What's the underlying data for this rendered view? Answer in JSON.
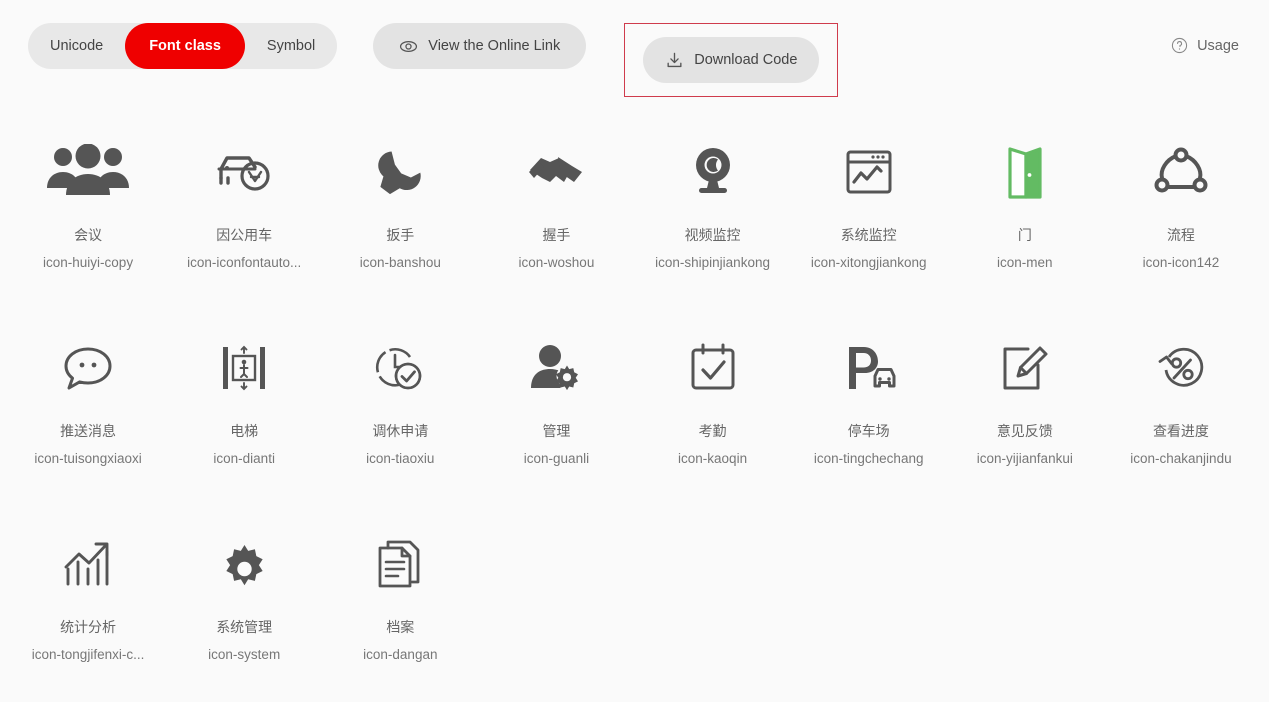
{
  "header": {
    "tabs": [
      {
        "label": "Unicode",
        "active": false
      },
      {
        "label": "Font class",
        "active": true
      },
      {
        "label": "Symbol",
        "active": false
      }
    ],
    "online_link_label": "View the Online Link",
    "online_link_icon": "eye-icon",
    "download_label": "Download Code",
    "download_icon": "download-icon",
    "usage_label": "Usage",
    "usage_icon": "question-circle-icon",
    "accent_color": "#ef0000",
    "highlight_border_color": "#cf3b4c",
    "pill_bg": "#e3e3e3"
  },
  "icons": [
    {
      "name": "会议",
      "code": "icon-huiyi-copy",
      "glyph": "users-group-icon",
      "color": "#555555"
    },
    {
      "name": "因公用车",
      "code": "icon-iconfontauto...",
      "glyph": "official-car-icon",
      "color": "#555555"
    },
    {
      "name": "扳手",
      "code": "icon-banshou",
      "glyph": "wrench-icon",
      "color": "#555555"
    },
    {
      "name": "握手",
      "code": "icon-woshou",
      "glyph": "handshake-icon",
      "color": "#555555"
    },
    {
      "name": "视频监控",
      "code": "icon-shipinjiankong",
      "glyph": "webcam-icon",
      "color": "#555555"
    },
    {
      "name": "系统监控",
      "code": "icon-xitongjiankong",
      "glyph": "system-monitor-icon",
      "color": "#555555"
    },
    {
      "name": "门",
      "code": "icon-men",
      "glyph": "door-icon",
      "color": "#63bb63"
    },
    {
      "name": "流程",
      "code": "icon-icon142",
      "glyph": "flow-nodes-icon",
      "color": "#555555"
    },
    {
      "name": "推送消息",
      "code": "icon-tuisongxiaoxi",
      "glyph": "chat-bubble-icon",
      "color": "#555555"
    },
    {
      "name": "电梯",
      "code": "icon-dianti",
      "glyph": "elevator-icon",
      "color": "#555555"
    },
    {
      "name": "调休申请",
      "code": "icon-tiaoxiu",
      "glyph": "clock-check-icon",
      "color": "#555555"
    },
    {
      "name": "管理",
      "code": "icon-guanli",
      "glyph": "user-gear-icon",
      "color": "#555555"
    },
    {
      "name": "考勤",
      "code": "icon-kaoqin",
      "glyph": "calendar-check-icon",
      "color": "#555555"
    },
    {
      "name": "停车场",
      "code": "icon-tingchechang",
      "glyph": "parking-car-icon",
      "color": "#555555"
    },
    {
      "name": "意见反馈",
      "code": "icon-yijianfankui",
      "glyph": "edit-pencil-square-icon",
      "color": "#555555"
    },
    {
      "name": "查看进度",
      "code": "icon-chakanjindu",
      "glyph": "percent-circle-icon",
      "color": "#555555"
    },
    {
      "name": "统计分析",
      "code": "icon-tongjifenxi-c...",
      "glyph": "bar-chart-arrow-icon",
      "color": "#555555"
    },
    {
      "name": "系统管理",
      "code": "icon-system",
      "glyph": "gear-icon",
      "color": "#555555"
    },
    {
      "name": "档案",
      "code": "icon-dangan",
      "glyph": "documents-icon",
      "color": "#555555"
    }
  ]
}
